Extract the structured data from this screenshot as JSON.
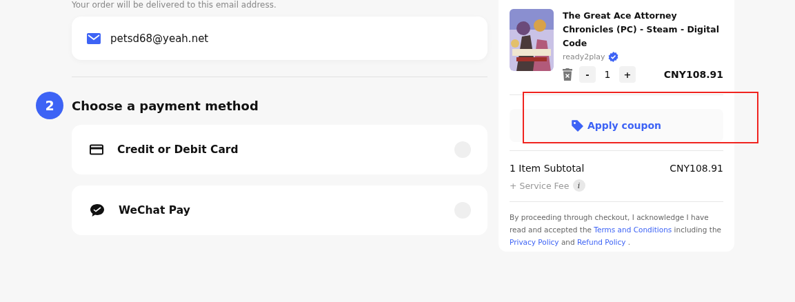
{
  "email_section": {
    "note": "Your order will be delivered to this email address.",
    "email": "petsd68@yeah.net"
  },
  "payment_section": {
    "step": "2",
    "title": "Choose a payment method",
    "methods": [
      {
        "kind": "card",
        "label": "Credit or Debit Card",
        "selected": false
      },
      {
        "kind": "wechat",
        "label": "WeChat Pay",
        "selected": false
      }
    ]
  },
  "cart": {
    "product": {
      "title": "The Great Ace Attorney Chronicles (PC) - Steam - Digital Code",
      "seller": "ready2play",
      "verified": true,
      "decrease": "-",
      "quantity": "1",
      "increase": "+",
      "price": "CNY108.91"
    },
    "coupon": "Apply coupon",
    "subtotal_label": "1 Item Subtotal",
    "subtotal": "CNY108.91",
    "service_fee": "+ Service Fee",
    "info": "i",
    "legal": [
      "By proceeding through checkout, I acknowledge I have read and accepted the ",
      "Terms and Conditions",
      " including the ",
      "Privacy Policy",
      " and ",
      "Refund Policy",
      " ."
    ]
  },
  "annotation": {
    "highlight": true
  }
}
